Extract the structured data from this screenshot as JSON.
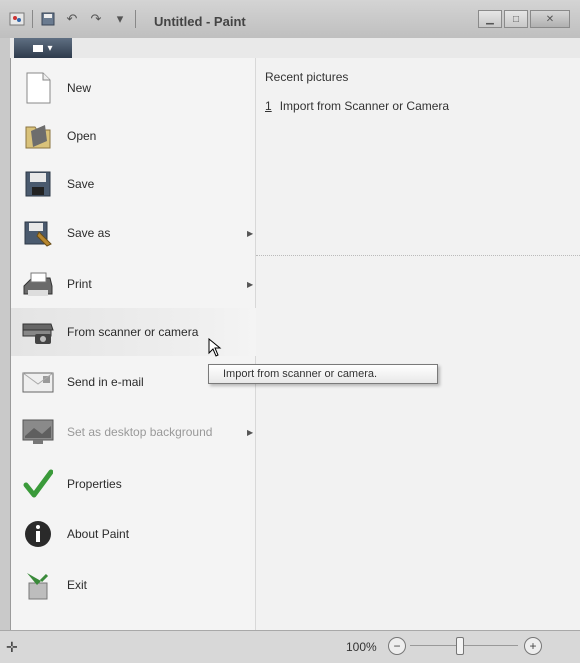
{
  "window": {
    "title": "Untitled - Paint",
    "app_button_label": "▾"
  },
  "menu": {
    "items": [
      {
        "label": "New",
        "icon": "new-document-icon",
        "has_submenu": false,
        "enabled": true
      },
      {
        "label": "Open",
        "icon": "open-folder-icon",
        "has_submenu": false,
        "enabled": true
      },
      {
        "label": "Save",
        "icon": "floppy-disk-icon",
        "has_submenu": false,
        "enabled": true
      },
      {
        "label": "Save as",
        "icon": "save-as-icon",
        "has_submenu": true,
        "enabled": true
      },
      {
        "label": "Print",
        "icon": "printer-icon",
        "has_submenu": true,
        "enabled": true
      },
      {
        "label": "From scanner or camera",
        "icon": "scanner-camera-icon",
        "has_submenu": false,
        "enabled": true
      },
      {
        "label": "Send in e-mail",
        "icon": "email-icon",
        "has_submenu": false,
        "enabled": true
      },
      {
        "label": "Set as desktop background",
        "icon": "desktop-background-icon",
        "has_submenu": true,
        "enabled": false
      },
      {
        "label": "Properties",
        "icon": "checkmark-icon",
        "has_submenu": false,
        "enabled": true
      },
      {
        "label": "About Paint",
        "icon": "info-icon",
        "has_submenu": false,
        "enabled": true
      },
      {
        "label": "Exit",
        "icon": "exit-icon",
        "has_submenu": false,
        "enabled": true
      }
    ],
    "hovered": "From scanner or camera"
  },
  "recent": {
    "title": "Recent pictures",
    "items": [
      {
        "number": "1",
        "label": "Import from Scanner or Camera"
      }
    ]
  },
  "tooltip": {
    "text": "Import from scanner or camera."
  },
  "statusbar": {
    "zoom_percent": "100%",
    "zoom_minus": "−",
    "zoom_plus": "+",
    "zoom_level": 0.5
  },
  "colors": {
    "app_button": "#3d4a5c",
    "menu_bg": "#f4f4f4",
    "checkmark": "#3a9a3a",
    "info": "#2a2a2a"
  }
}
